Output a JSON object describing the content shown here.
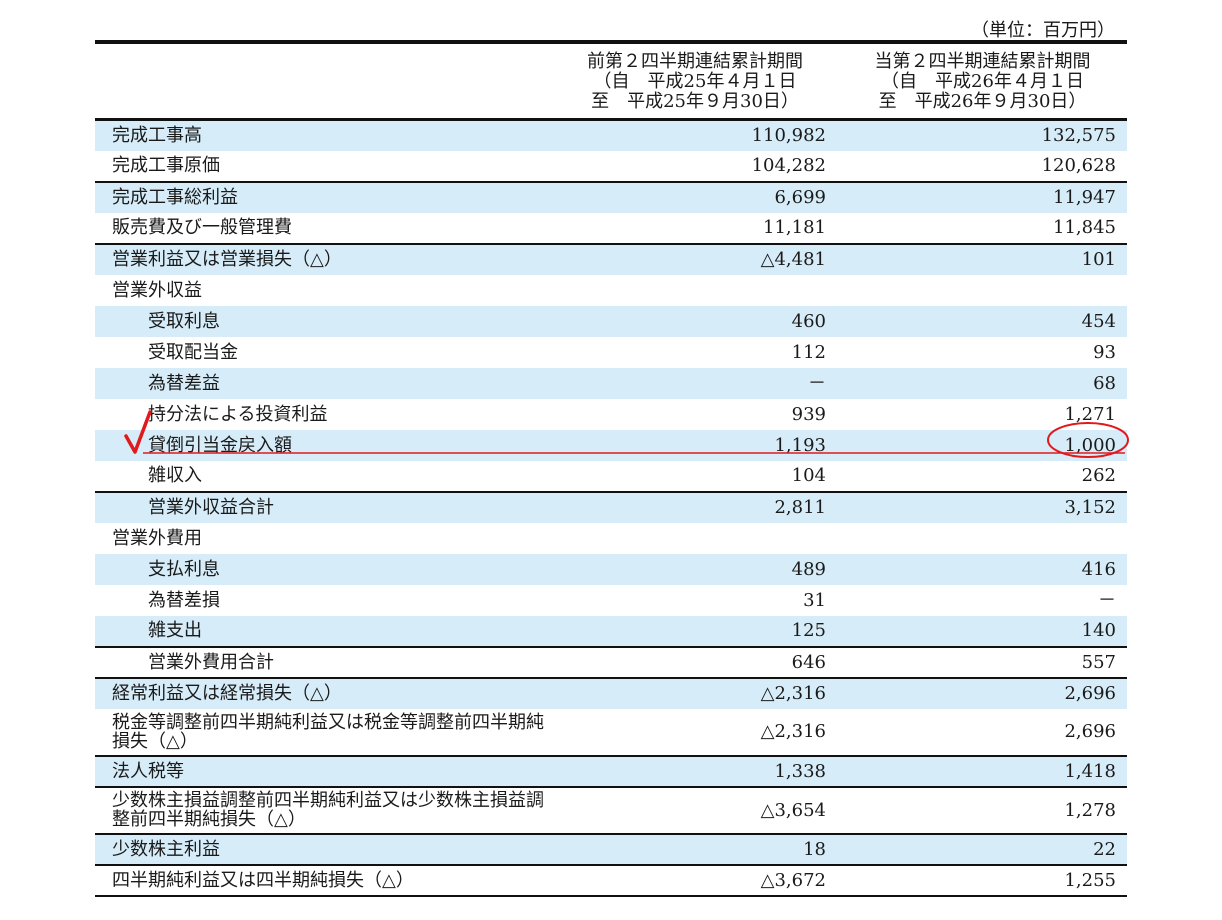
{
  "unit_label": "（単位：百万円）",
  "header": {
    "prev": [
      "前第２四半期連結累計期間",
      "（自　平成25年４月１日",
      "至　平成25年９月30日）"
    ],
    "curr": [
      "当第２四半期連結累計期間",
      "（自　平成26年４月１日",
      "至　平成26年９月30日）"
    ]
  },
  "rows": [
    {
      "label": "完成工事高",
      "prev": "110,982",
      "curr": "132,575"
    },
    {
      "label": "完成工事原価",
      "prev": "104,282",
      "curr": "120,628"
    },
    {
      "label": "完成工事総利益",
      "prev": "6,699",
      "curr": "11,947"
    },
    {
      "label": "販売費及び一般管理費",
      "prev": "11,181",
      "curr": "11,845"
    },
    {
      "label": "営業利益又は営業損失（△）",
      "prev": "△4,481",
      "curr": "101"
    },
    {
      "label": "営業外収益",
      "prev": "",
      "curr": ""
    },
    {
      "label": "受取利息",
      "prev": "460",
      "curr": "454"
    },
    {
      "label": "受取配当金",
      "prev": "112",
      "curr": "93"
    },
    {
      "label": "為替差益",
      "prev": "－",
      "curr": "68"
    },
    {
      "label": "持分法による投資利益",
      "prev": "939",
      "curr": "1,271"
    },
    {
      "label": "貸倒引当金戻入額",
      "prev": "1,193",
      "curr": "1,000"
    },
    {
      "label": "雑収入",
      "prev": "104",
      "curr": "262"
    },
    {
      "label": "営業外収益合計",
      "prev": "2,811",
      "curr": "3,152"
    },
    {
      "label": "営業外費用",
      "prev": "",
      "curr": ""
    },
    {
      "label": "支払利息",
      "prev": "489",
      "curr": "416"
    },
    {
      "label": "為替差損",
      "prev": "31",
      "curr": "－"
    },
    {
      "label": "雑支出",
      "prev": "125",
      "curr": "140"
    },
    {
      "label": "営業外費用合計",
      "prev": "646",
      "curr": "557"
    },
    {
      "label": "経常利益又は経常損失（△）",
      "prev": "△2,316",
      "curr": "2,696"
    },
    {
      "label": "税金等調整前四半期純利益又は税金等調整前四半期純損失（△）",
      "prev": "△2,316",
      "curr": "2,696"
    },
    {
      "label": "法人税等",
      "prev": "1,338",
      "curr": "1,418"
    },
    {
      "label": "少数株主損益調整前四半期純利益又は少数株主損益調整前四半期純損失（△）",
      "prev": "△3,654",
      "curr": "1,278"
    },
    {
      "label": "少数株主利益",
      "prev": "18",
      "curr": "22"
    },
    {
      "label": "四半期純利益又は四半期純損失（△）",
      "prev": "△3,672",
      "curr": "1,255"
    }
  ],
  "annotations": {
    "checkmark_icon": "red-checkmark-icon",
    "circle_icon": "red-ellipse-icon",
    "underline_icon": "red-underline-icon",
    "annotation_color": "#e0191c",
    "shade_color": "#d6ecf8"
  }
}
